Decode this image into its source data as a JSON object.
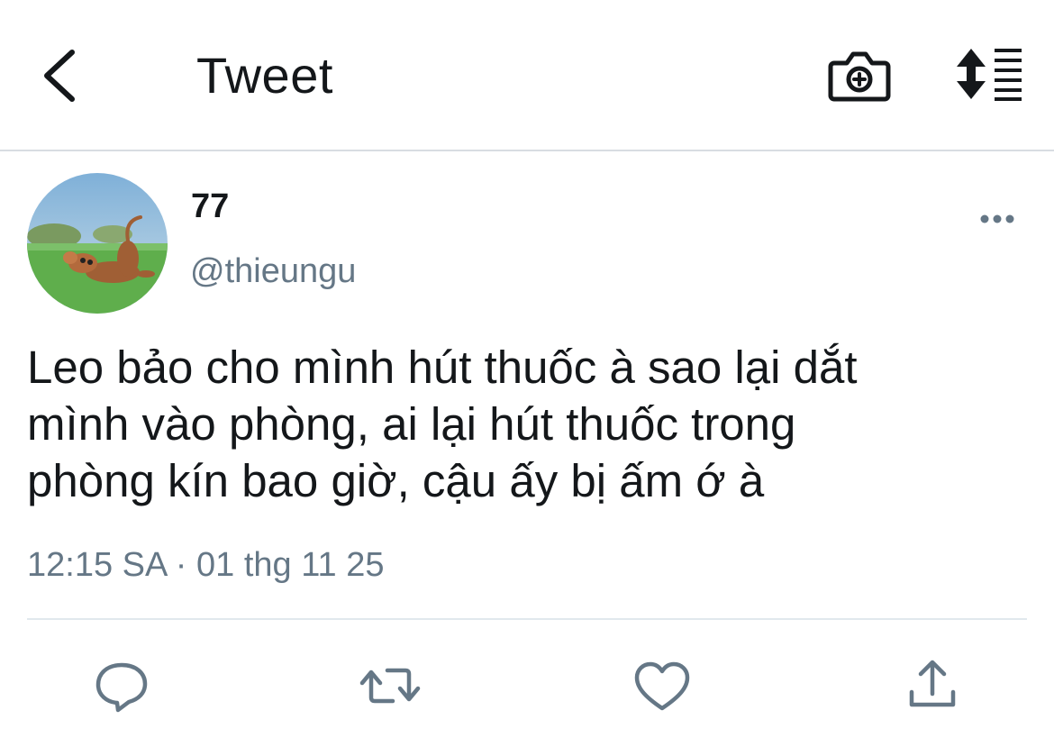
{
  "header": {
    "title": "Tweet",
    "back_icon": "chevron-left-icon",
    "camera_icon": "camera-plus-icon",
    "sort_icon": "sort-list-icon"
  },
  "tweet": {
    "display_name": "77",
    "handle": "@thieungu",
    "text_lines": [
      "Leo bảo cho mình hút thuốc à sao lại dắt",
      "mình vào phòng, ai lại hút thuốc trong",
      "phòng kín bao giờ, cậu ấy bị ấm ớ à"
    ],
    "timestamp": "12:15 SA · 01 thg 11 25"
  },
  "actions": {
    "icons": [
      "reply-icon",
      "retweet-icon",
      "like-icon",
      "share-icon"
    ]
  },
  "colors": {
    "text": "#14171a",
    "secondary": "#657786",
    "icon": "#657786",
    "divider": "#e1e8ed"
  }
}
